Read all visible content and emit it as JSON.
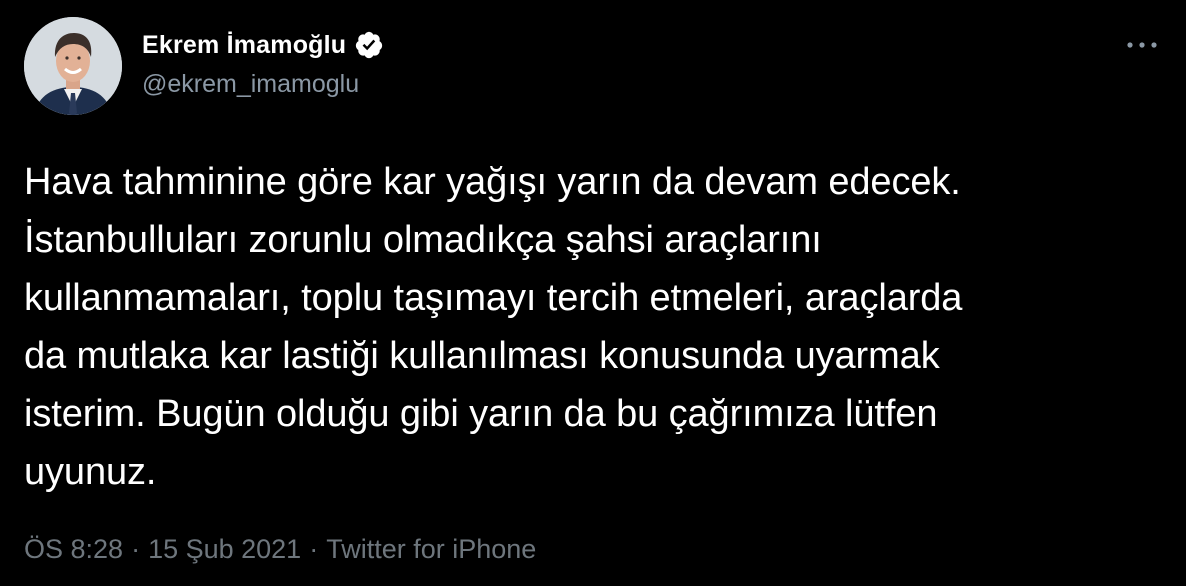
{
  "author": {
    "display_name": "Ekrem İmamoğlu",
    "handle": "@ekrem_imamoglu",
    "verified": true,
    "avatar_icon": "profile-photo"
  },
  "tweet": {
    "text": "Hava tahminine göre kar yağışı yarın da devam edecek.\nİstanbulluları zorunlu olmadıkça şahsi araçlarını\nkullanmamaları, toplu taşımayı tercih etmeleri, araçlarda\nda mutlaka kar lastiği kullanılması konusunda uyarmak\nisterim. Bugün olduğu gibi yarın da bu çağrımıza lütfen\nuyunuz."
  },
  "meta": {
    "time": "ÖS 8:28",
    "date": "15 Şub 2021",
    "source": "Twitter for iPhone",
    "separator": "·"
  },
  "icons": {
    "more": "more-horizontal-icon",
    "verified": "verified-badge-icon"
  },
  "colors": {
    "background": "#000000",
    "primary_text": "#ffffff",
    "secondary_text": "#8b98a5",
    "meta_text": "#6e767d"
  }
}
